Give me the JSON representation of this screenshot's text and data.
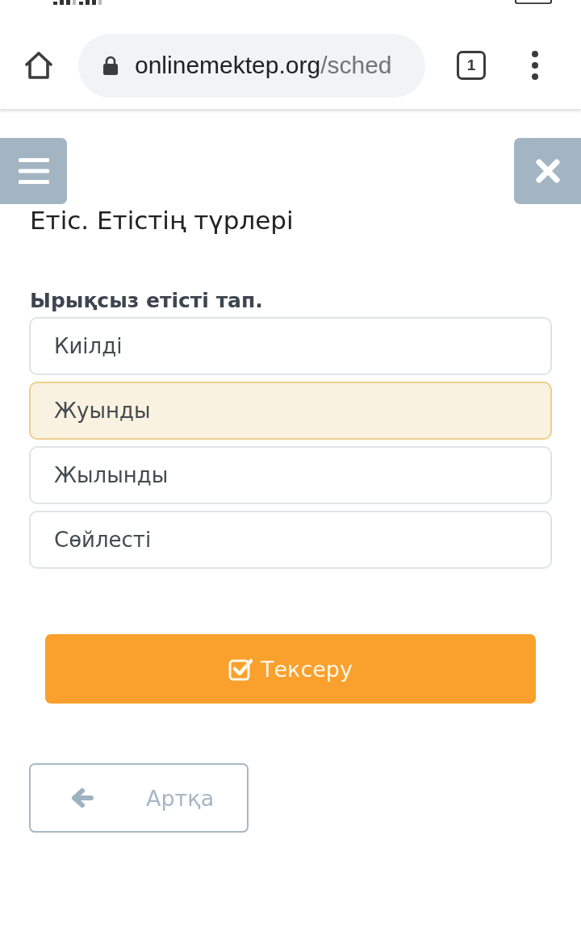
{
  "browser": {
    "url_host": "onlinemektep.org",
    "url_path": "/sched",
    "tab_count": "1"
  },
  "quiz": {
    "title": "Етіс. Етістің түрлері",
    "question": "Ырықсыз етісті тап.",
    "options": [
      {
        "label": "Киілді",
        "selected": false
      },
      {
        "label": "Жуынды",
        "selected": true
      },
      {
        "label": "Жылынды",
        "selected": false
      },
      {
        "label": "Сөйлесті",
        "selected": false
      }
    ],
    "check_button": "Тексеру",
    "back_button": "Артқа"
  }
}
